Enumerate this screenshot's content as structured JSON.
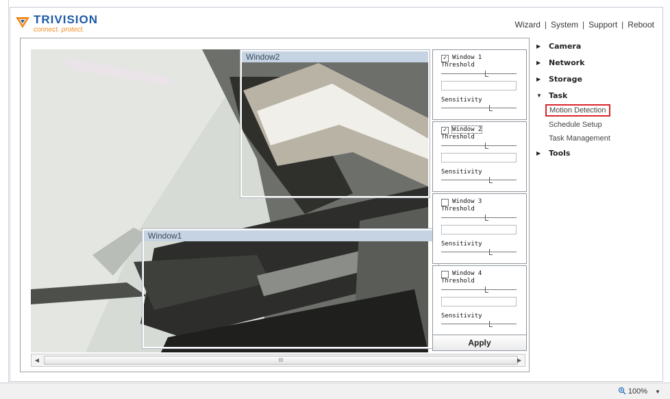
{
  "brand": {
    "name": "TRIVISION",
    "tagline": "connect. protect."
  },
  "topnav": {
    "items": [
      "Wizard",
      "System",
      "Support",
      "Reboot"
    ]
  },
  "windows_overlay": [
    {
      "title": "Window2"
    },
    {
      "title": "Window1"
    }
  ],
  "panels": [
    {
      "label": "Window 1",
      "checked": true,
      "threshold_label": "Threshold",
      "sensitivity_label": "Sensitivity",
      "checkmark": "✓"
    },
    {
      "label": "Window 2",
      "checked": true,
      "threshold_label": "Threshold",
      "sensitivity_label": "Sensitivity",
      "checkmark": "✓"
    },
    {
      "label": "Window 3",
      "checked": false,
      "threshold_label": "Threshold",
      "sensitivity_label": "Sensitivity",
      "checkmark": ""
    },
    {
      "label": "Window 4",
      "checked": false,
      "threshold_label": "Threshold",
      "sensitivity_label": "Sensitivity",
      "checkmark": ""
    }
  ],
  "apply_label": "Apply",
  "scrollbar": {
    "left_arrow": "◀",
    "right_arrow": "▶",
    "grip": "III"
  },
  "sidebar": {
    "sections": [
      {
        "label": "Camera",
        "expanded": false
      },
      {
        "label": "Network",
        "expanded": false
      },
      {
        "label": "Storage",
        "expanded": false
      },
      {
        "label": "Task",
        "expanded": true
      },
      {
        "label": "Tools",
        "expanded": false
      }
    ],
    "task_items": [
      {
        "label": "Motion Detection",
        "active": true
      },
      {
        "label": "Schedule Setup",
        "active": false
      },
      {
        "label": "Task Management",
        "active": false
      }
    ],
    "collapsed_icon": "▶",
    "expanded_icon": "▼"
  },
  "status": {
    "zoom": "100%",
    "zoom_icon": "magnifier-icon",
    "dropdown_icon": "▼"
  },
  "colors": {
    "brand_blue": "#1d5aa7",
    "brand_orange": "#f08a1c",
    "active_outline": "#d9242b"
  }
}
